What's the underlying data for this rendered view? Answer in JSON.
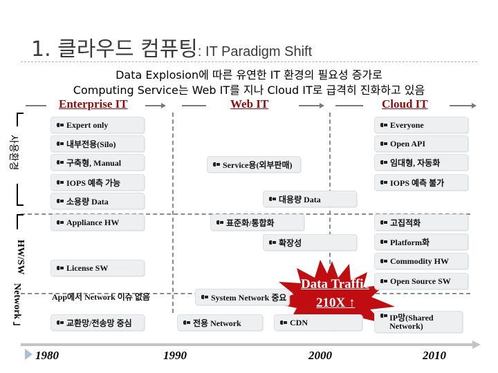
{
  "title": {
    "main": "1. 클라우드 컴퓨팅",
    "sub": ": IT Paradigm Shift"
  },
  "headline": {
    "line1": "Data Explosion에 따른 유연한 IT 환경의 필요성 증가로",
    "line2": "Computing Service는 Web IT를 지나 Cloud IT로 급격히 진화하고 있음"
  },
  "eras": [
    "Enterprise IT",
    "Web IT",
    "Cloud IT"
  ],
  "side_labels": {
    "usage": "사용환경",
    "hwsw": "HW/SW",
    "network": "Network 」"
  },
  "usage": {
    "enterprise": [
      "Expert only",
      "내부전용(Silo)",
      "구축형, Manual",
      "IOPS 예측 가능",
      "소용량 Data"
    ],
    "web": [
      "Service용(외부판매)"
    ],
    "transition": [
      "대용량 Data"
    ],
    "cloud": [
      "Everyone",
      "Open API",
      "임대형, 자동화",
      "IOPS 예측 불가"
    ]
  },
  "hwsw": {
    "enterprise": [
      "Appliance HW",
      "License SW"
    ],
    "web": [
      "표준화/통합화"
    ],
    "transition": [
      "확장성"
    ],
    "cloud": [
      "고집적화",
      "Platform화",
      "Commodity HW",
      "Open Source SW"
    ]
  },
  "network": {
    "enterprise_note": "App에서 Network 이슈 없음",
    "enterprise": [
      "교환망/전송망 중심"
    ],
    "web": [
      "System Network 중요",
      "전용 Network"
    ],
    "transition": [
      "CDN"
    ],
    "cloud": [
      "IP망(Shared Network)"
    ]
  },
  "callout": {
    "line1": "Data Traffic",
    "line2": "210X ↑",
    "color": "#c00d12"
  },
  "timeline": [
    "1980",
    "1990",
    "2000",
    "2010"
  ],
  "colors": {
    "era_text": "#8b0f0f",
    "box_bg": "#eeeff0",
    "axis": "#c4c4c4"
  }
}
